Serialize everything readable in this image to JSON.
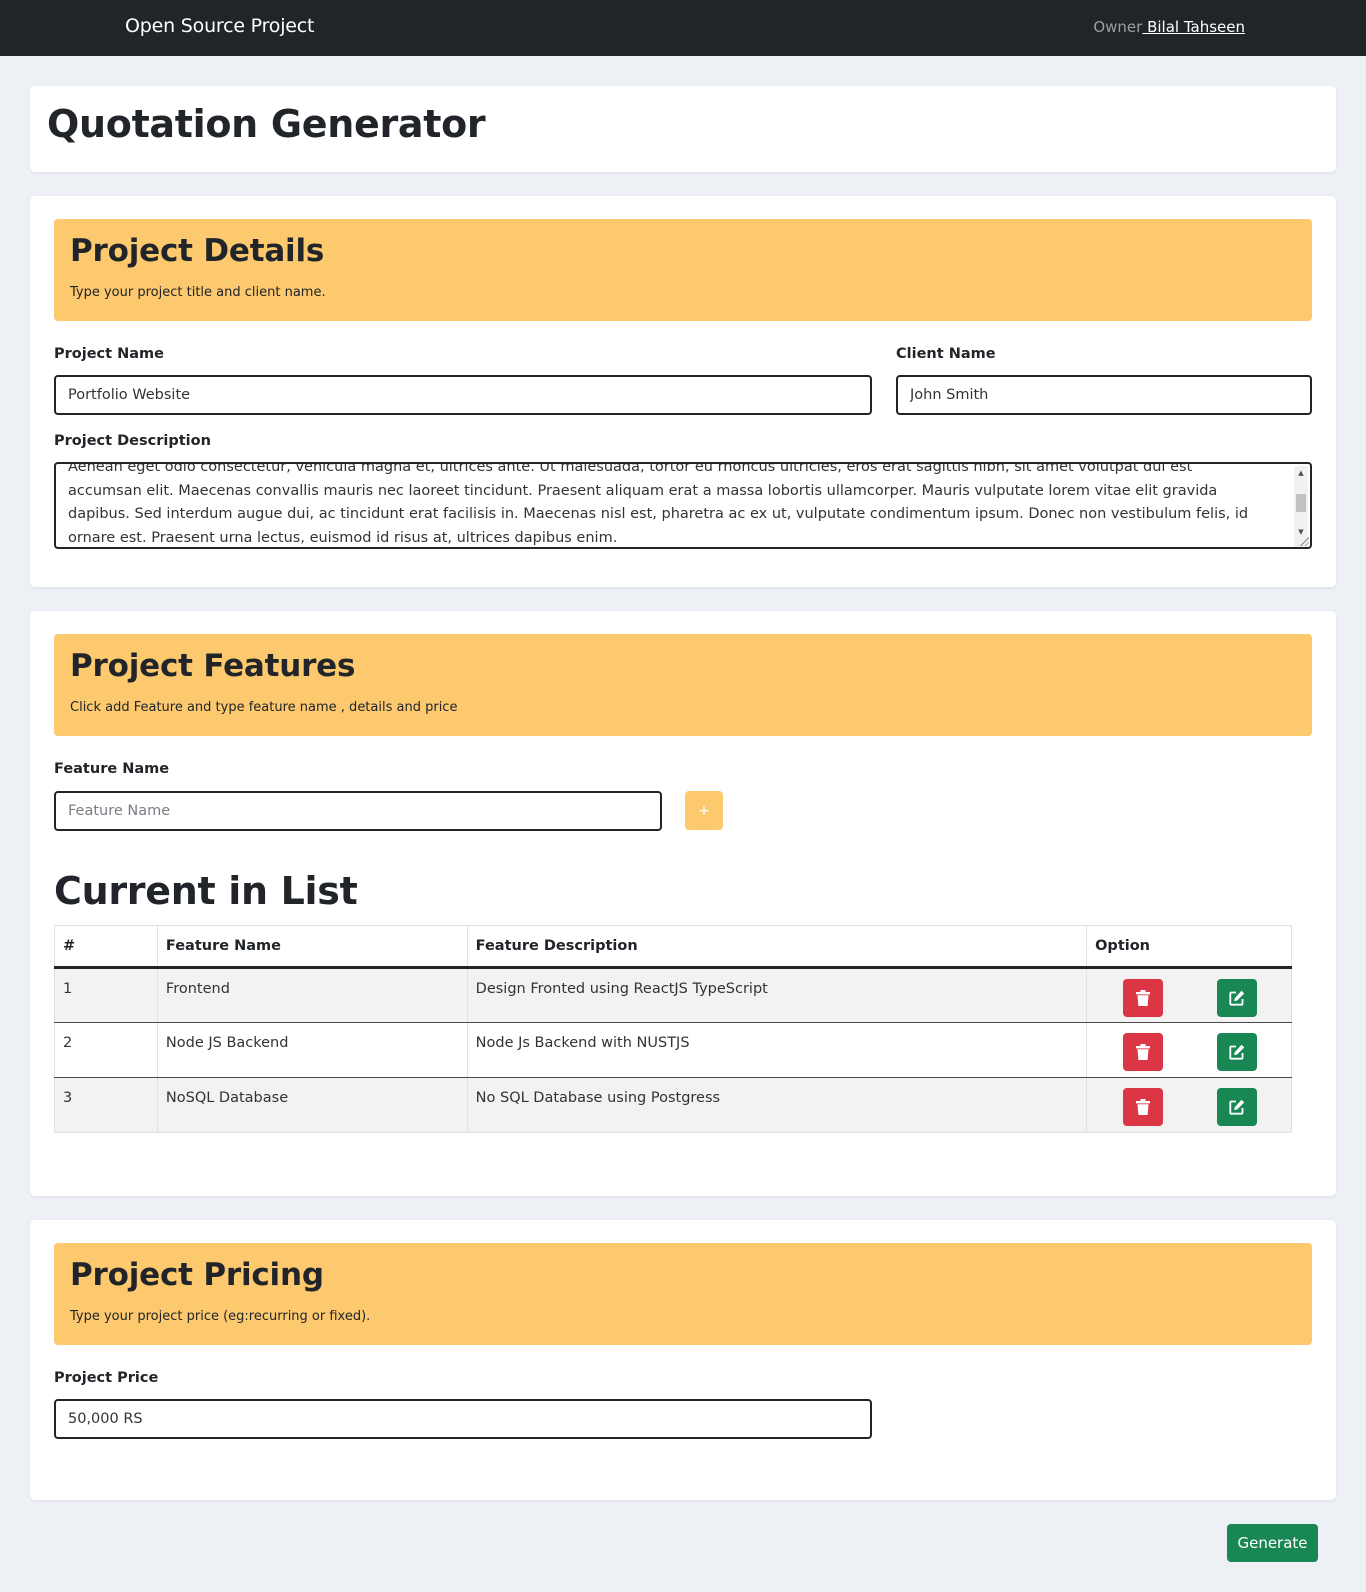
{
  "navbar": {
    "brand": "Open Source Project",
    "owner_label": "Owner",
    "owner_name": " Bilal Tahseen"
  },
  "page_title": "Quotation Generator",
  "details": {
    "heading": "Project Details",
    "subtitle": "Type your project title and client name.",
    "project_name_label": "Project Name",
    "project_name_value": "Portfolio Website",
    "client_name_label": "Client Name",
    "client_name_value": "John Smith",
    "description_label": "Project Description",
    "description_value": "Aenean eget odio consectetur, vehicula magna et, ultrices ante. Ut malesuada, tortor eu rhoncus ultricies, eros erat sagittis nibh, sit amet volutpat dui est accumsan elit. Maecenas convallis mauris nec laoreet tincidunt. Praesent aliquam erat a massa lobortis ullamcorper. Mauris vulputate lorem vitae elit gravida dapibus. Sed interdum augue dui, ac tincidunt erat facilisis in. Maecenas nisl est, pharetra ac ex ut, vulputate condimentum ipsum. Donec non vestibulum felis, id ornare est. Praesent urna lectus, euismod id risus at, ultrices dapibus enim."
  },
  "features": {
    "heading": "Project Features",
    "subtitle": "Click add Feature and type feature name , details and price",
    "feature_name_label": "Feature Name",
    "feature_name_placeholder": "Feature Name",
    "add_button": "+",
    "list_title": "Current in List",
    "columns": [
      "#",
      "Feature Name",
      "Feature Description",
      "Option"
    ],
    "rows": [
      {
        "num": "1",
        "name": "Frontend",
        "description": "Design Fronted using ReactJS TypeScript"
      },
      {
        "num": "2",
        "name": "Node JS Backend",
        "description": "Node Js Backend with NUSTJS"
      },
      {
        "num": "3",
        "name": "NoSQL Database",
        "description": "No SQL Database using Postgress"
      }
    ]
  },
  "pricing": {
    "heading": "Project Pricing",
    "subtitle": "Type your project price (eg:recurring or fixed).",
    "price_label": "Project Price",
    "price_value": "50,000 RS"
  },
  "generate_button": "Generate",
  "icons": {
    "delete": "trash-icon",
    "edit": "edit-icon"
  },
  "colors": {
    "navbar": "#212529",
    "section_header": "#fcc96f",
    "danger": "#dc3545",
    "success": "#198754",
    "background": "#edf1f5"
  }
}
